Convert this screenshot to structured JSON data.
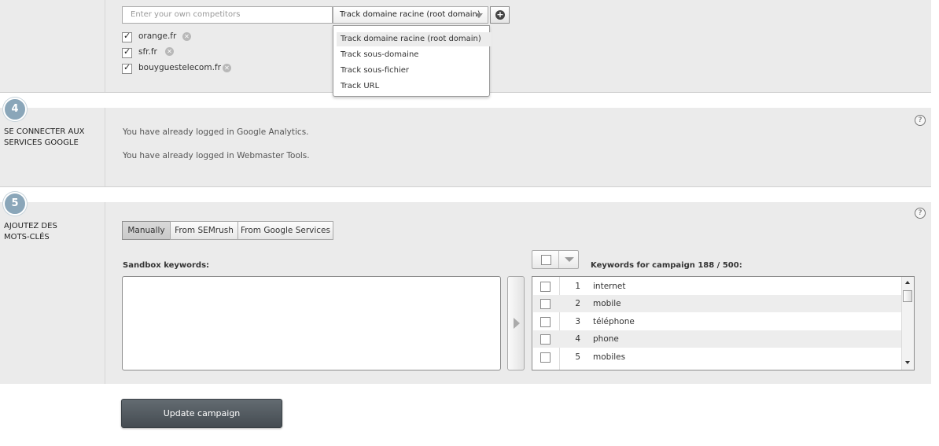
{
  "competitors": {
    "placeholder": "Enter your own competitors",
    "track_selected": "Track domaine racine (root domain)",
    "items": [
      "orange.fr",
      "sfr.fr",
      "bouyguestelecom.fr"
    ],
    "dropdown_options": [
      "Track domaine racine (root domain)",
      "Track sous-domaine",
      "Track sous-fichier",
      "Track URL"
    ]
  },
  "step4": {
    "number": "4",
    "title_line1": "SE CONNECTER AUX",
    "title_line2": "SERVICES GOOGLE",
    "messages": [
      "You have already logged in Google Analytics.",
      "You have already logged in Webmaster Tools."
    ],
    "help": "?"
  },
  "step5": {
    "number": "5",
    "title_line1": "AJOUTEZ DES",
    "title_line2": "MOTS-CLÉS",
    "help": "?",
    "tabs": [
      "Manually",
      "From SEMrush",
      "From Google Services"
    ],
    "sandbox_label": "Sandbox keywords:",
    "campaign_label": "Keywords for campaign 188 / 500:",
    "keywords": [
      {
        "n": "1",
        "word": "internet"
      },
      {
        "n": "2",
        "word": "mobile"
      },
      {
        "n": "3",
        "word": "téléphone"
      },
      {
        "n": "4",
        "word": "phone"
      },
      {
        "n": "5",
        "word": "mobiles"
      }
    ]
  },
  "footer": {
    "update_button": "Update campaign"
  }
}
